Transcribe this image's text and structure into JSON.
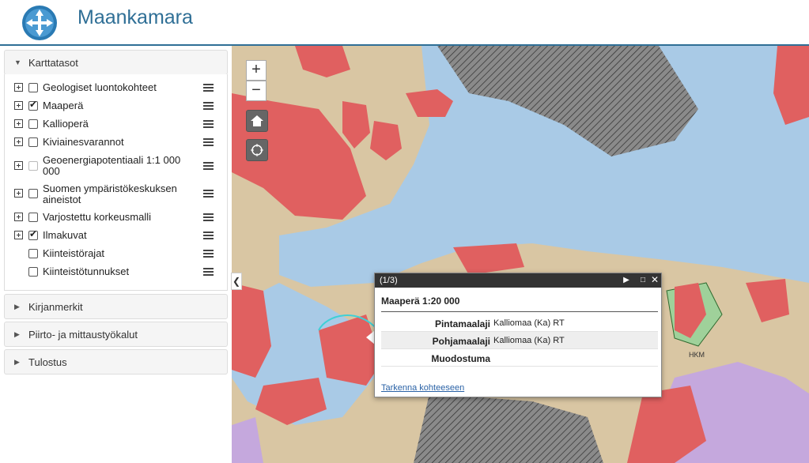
{
  "app": {
    "title": "Maankamara"
  },
  "sidebar": {
    "sections": [
      {
        "label": "Karttatasot",
        "expanded": true
      },
      {
        "label": "Kirjanmerkit",
        "expanded": false
      },
      {
        "label": "Piirto- ja mittaustyökalut",
        "expanded": false
      },
      {
        "label": "Tulostus",
        "expanded": false
      }
    ],
    "layers": [
      {
        "name": "Geologiset luontokohteet",
        "checked": false,
        "expandable": true,
        "enabled": true
      },
      {
        "name": "Maaperä",
        "checked": true,
        "expandable": true,
        "enabled": true
      },
      {
        "name": "Kallioperä",
        "checked": false,
        "expandable": true,
        "enabled": true
      },
      {
        "name": "Kiviainesvarannot",
        "checked": false,
        "expandable": true,
        "enabled": true
      },
      {
        "name": "Geoenergiapotentiaali 1:1 000 000",
        "checked": false,
        "expandable": true,
        "enabled": false
      },
      {
        "name": "Suomen ympäristökeskuksen aineistot",
        "checked": false,
        "expandable": true,
        "enabled": true
      },
      {
        "name": "Varjostettu korkeusmalli",
        "checked": false,
        "expandable": true,
        "enabled": true
      },
      {
        "name": "Ilmakuvat",
        "checked": true,
        "expandable": true,
        "enabled": true
      },
      {
        "name": "Kiinteistörajat",
        "checked": false,
        "expandable": false,
        "enabled": true
      },
      {
        "name": "Kiinteistötunnukset",
        "checked": false,
        "expandable": false,
        "enabled": true
      }
    ]
  },
  "map": {
    "zoom_in": "+",
    "zoom_out": "−",
    "label_hkm": "HKM",
    "colors": {
      "rock": "#e06060",
      "water": "#a6c8e6",
      "sand": "#dcc9a6",
      "clay": "#c5a8dd",
      "hatch": "#555555",
      "highlight": "#3fd0d6",
      "green": "#9fd19a"
    }
  },
  "popup": {
    "counter": "(1/3)",
    "title": "Maaperä 1:20 000",
    "rows": [
      {
        "key": "Pintamaalaji",
        "value": "Kalliomaa (Ka) RT"
      },
      {
        "key": "Pohjamaalaji",
        "value": "Kalliomaa (Ka) RT"
      },
      {
        "key": "Muodostuma",
        "value": ""
      }
    ],
    "link": "Tarkenna kohteeseen"
  }
}
